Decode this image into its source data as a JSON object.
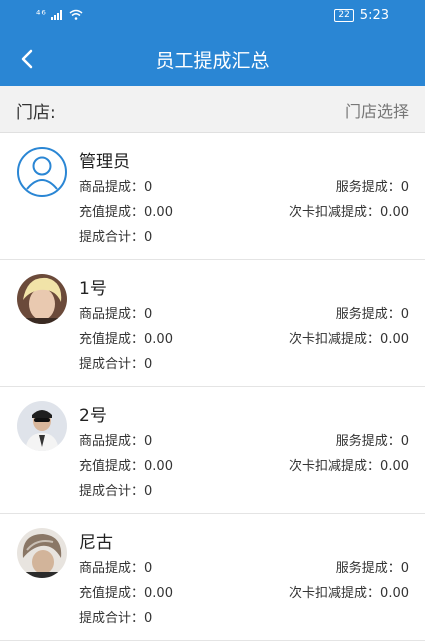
{
  "status_bar": {
    "signal": "⁴⁶",
    "battery": "22",
    "time": "5:23"
  },
  "header": {
    "title": "员工提成汇总"
  },
  "store": {
    "label": "门店:",
    "select_label": "门店选择"
  },
  "labels": {
    "goods": "商品提成：",
    "service": "服务提成：",
    "recharge": "充值提成：",
    "card_deduct": "次卡扣减提成：",
    "total": "提成合计："
  },
  "employees": [
    {
      "name": "管理员",
      "goods": "0",
      "service": "0",
      "recharge": "0.00",
      "card_deduct": "0.00",
      "total": "0"
    },
    {
      "name": "1号",
      "goods": "0",
      "service": "0",
      "recharge": "0.00",
      "card_deduct": "0.00",
      "total": "0"
    },
    {
      "name": "2号",
      "goods": "0",
      "service": "0",
      "recharge": "0.00",
      "card_deduct": "0.00",
      "total": "0"
    },
    {
      "name": "尼古",
      "goods": "0",
      "service": "0",
      "recharge": "0.00",
      "card_deduct": "0.00",
      "total": "0"
    }
  ],
  "colors": {
    "primary": "#2a86d4",
    "store_bar_bg": "#f2f2f2"
  }
}
